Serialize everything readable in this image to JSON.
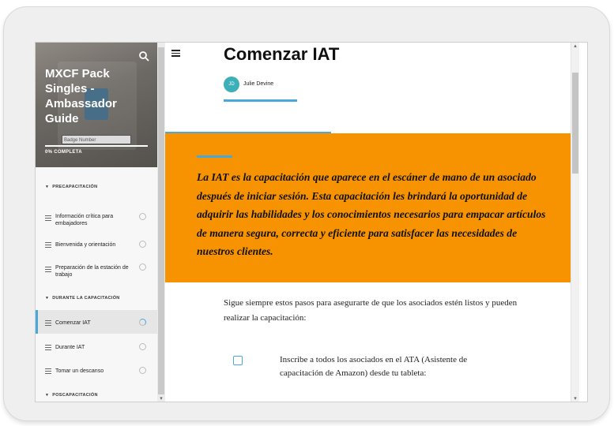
{
  "sidebar": {
    "course_title": "MXCF Pack Singles - Ambassador Guide",
    "badge_input_placeholder": "Badge Number",
    "progress_text": "0% COMPLETA",
    "sections": [
      {
        "title": "PRECAPACITACIÓN",
        "items": [
          {
            "label": "Información crítica para embajadores",
            "status": "not-started"
          },
          {
            "label": "Bienvenida y orientación",
            "status": "not-started"
          },
          {
            "label": "Preparación de la estación de trabajo",
            "status": "not-started"
          }
        ]
      },
      {
        "title": "DURANTE LA CAPACITACIÓN",
        "items": [
          {
            "label": "Comenzar IAT",
            "status": "in-progress",
            "active": true
          },
          {
            "label": "Durante IAT",
            "status": "not-started"
          },
          {
            "label": "Tomar un descanso",
            "status": "not-started"
          }
        ]
      },
      {
        "title": "POSCAPACITACIÓN",
        "items": []
      }
    ]
  },
  "main": {
    "page_title": "Comenzar IAT",
    "author": {
      "initials": "JD",
      "name": "Julie Devine"
    },
    "banner_text": "La IAT es la capacitación que aparece en el escáner de mano de un asociado después de iniciar sesión. Esta capacitación les brindará la oportunidad de adquirir las habilidades y los conocimientos necesarios para empacar artículos de manera segura, correcta y eficiente para satisfacer las necesidades de nuestros clientes.",
    "intro_text": "Sigue siempre estos pasos para asegurarte de que los asociados estén listos y pueden realizar la capacitación:",
    "checklist": [
      {
        "label": "Inscribe a todos los asociados en el ATA (Asistente de capacitación de Amazon) desde tu tableta:",
        "checked": false
      }
    ]
  },
  "colors": {
    "accent": "#4aa8d8",
    "banner": "#f79300",
    "avatar": "#3bb0b8"
  }
}
